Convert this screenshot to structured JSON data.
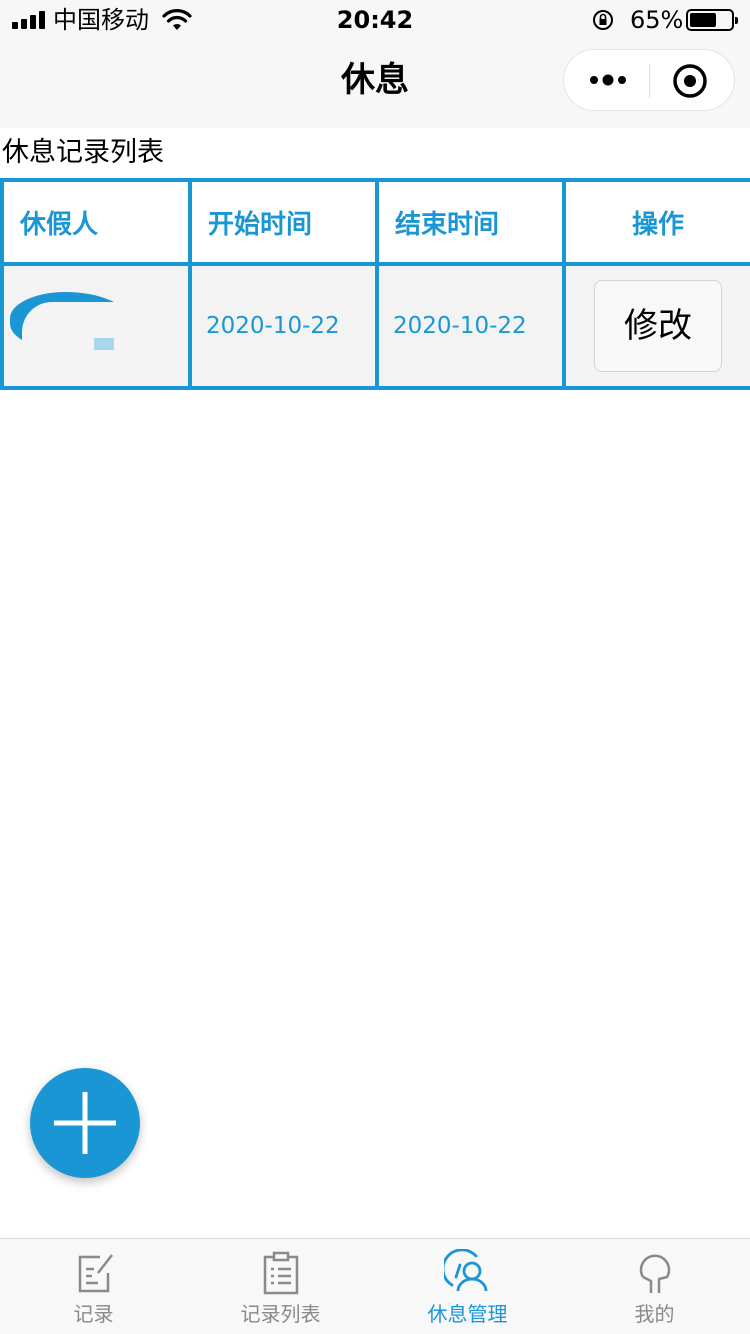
{
  "status_bar": {
    "carrier": "中国移动",
    "time": "20:42",
    "battery_percent": "65%",
    "battery_level": 0.65
  },
  "nav": {
    "title": "休息"
  },
  "section_title": "休息记录列表",
  "table": {
    "headers": [
      "休假人",
      "开始时间",
      "结束时间",
      "操作"
    ],
    "rows": [
      {
        "start": "2020-10-22",
        "end": "2020-10-22",
        "action_label": "修改"
      }
    ]
  },
  "fab": {
    "icon": "plus-icon"
  },
  "tab_bar": {
    "items": [
      {
        "label": "记录",
        "icon": "edit-note-icon",
        "active": false
      },
      {
        "label": "记录列表",
        "icon": "clipboard-list-icon",
        "active": false
      },
      {
        "label": "休息管理",
        "icon": "user-manage-icon",
        "active": true
      },
      {
        "label": "我的",
        "icon": "profile-icon",
        "active": false
      }
    ]
  },
  "colors": {
    "accent": "#1a96d4",
    "inactive": "#8a8a8a",
    "nav_background": "#f7f7f7"
  }
}
